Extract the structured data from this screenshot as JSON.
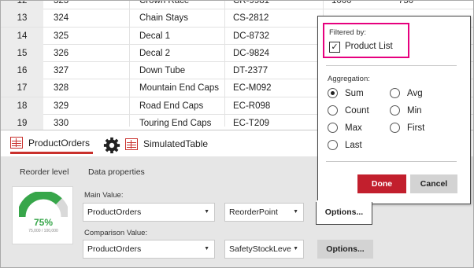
{
  "grid": {
    "rows": [
      {
        "num": "12",
        "id": "323",
        "name": "Crown Race",
        "code": "CR-9981",
        "v1": "1000",
        "v2": "750"
      },
      {
        "num": "13",
        "id": "324",
        "name": "Chain Stays",
        "code": "CS-2812",
        "v1": "",
        "v2": ""
      },
      {
        "num": "14",
        "id": "325",
        "name": "Decal 1",
        "code": "DC-8732",
        "v1": "",
        "v2": ""
      },
      {
        "num": "15",
        "id": "326",
        "name": "Decal 2",
        "code": "DC-9824",
        "v1": "",
        "v2": ""
      },
      {
        "num": "16",
        "id": "327",
        "name": "Down Tube",
        "code": "DT-2377",
        "v1": "",
        "v2": ""
      },
      {
        "num": "17",
        "id": "328",
        "name": "Mountain End Caps",
        "code": "EC-M092",
        "v1": "",
        "v2": ""
      },
      {
        "num": "18",
        "id": "329",
        "name": "Road End Caps",
        "code": "EC-R098",
        "v1": "",
        "v2": ""
      },
      {
        "num": "19",
        "id": "330",
        "name": "Touring End Caps",
        "code": "EC-T209",
        "v1": "",
        "v2": ""
      }
    ]
  },
  "tabs": {
    "tab1": {
      "label": "ProductOrders",
      "icon": "table-icon"
    },
    "tab2": {
      "label": "SimulatedTable",
      "icon": "table-icon"
    },
    "settings_icon": "gear-icon"
  },
  "panel": {
    "reorder_title": "Reorder level",
    "gauge": {
      "percent_label": "75%",
      "sub_label": "75,000 / 100,000",
      "fraction": 0.75,
      "color": "#37a64a"
    },
    "data_properties_title": "Data properties",
    "main_value_label": "Main Value:",
    "main_value_table": "ProductOrders",
    "main_value_column": "ReorderPoint",
    "comparison_value_label": "Comparison Value:",
    "comparison_value_table": "ProductOrders",
    "comparison_value_column": "SafetyStockLeve",
    "options_label": "Options..."
  },
  "popup": {
    "filtered_by_label": "Filtered by:",
    "filter_item": "Product List",
    "filter_checked": true,
    "aggregation_label": "Aggregation:",
    "options_left": [
      "Sum",
      "Count",
      "Max",
      "Last"
    ],
    "options_right": [
      "Avg",
      "Min",
      "First"
    ],
    "selected": "Sum",
    "done_label": "Done",
    "cancel_label": "Cancel",
    "accent_color": "#c21f2d",
    "highlight_color": "#e6007e"
  }
}
